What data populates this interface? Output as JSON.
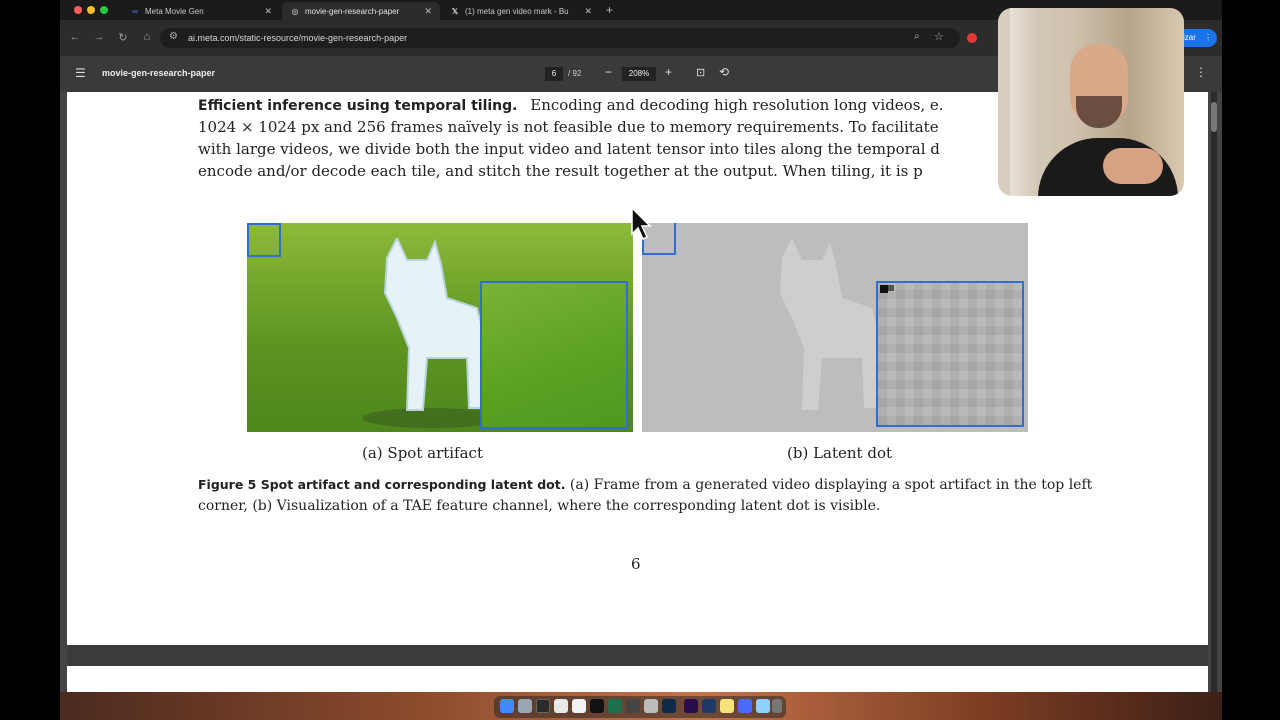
{
  "tabs": [
    {
      "label": "Meta Movie Gen",
      "favicon": "meta-icon",
      "active": false
    },
    {
      "label": "movie-gen-research-paper",
      "favicon": "globe-icon",
      "active": true
    },
    {
      "label": "(1) meta gen video mark - Bu",
      "favicon": "x-logo-icon",
      "active": false
    }
  ],
  "toolbar": {
    "url": "ai.meta.com/static-resource/movie-gen-research-paper",
    "profile_label": "izar"
  },
  "pdf": {
    "title": "movie-gen-research-paper",
    "current_page": "6",
    "total_pages": "/ 92",
    "zoom": "208%"
  },
  "page": {
    "paragraph_lead": "Efficient inference using temporal tiling.",
    "line1_rest": "Encoding and decoding high resolution long videos, e.",
    "line2": "1024 × 1024 px and 256 frames naïvely is not feasible due to memory requirements. To facilitate",
    "line3": "with large videos, we divide both the input video and latent tensor into tiles along the temporal d",
    "line4": "encode and/or decode each tile, and stitch the result together at the output. When tiling, it is p",
    "caption_a": "(a) Spot artifact",
    "caption_b": "(b) Latent dot",
    "figure_lead": "Figure 5  Spot artifact and corresponding latent dot.",
    "figure_text": "(a) Frame from a generated video displaying a spot artifact in the top left corner, (b) Visualization of a TAE feature channel, where the corresponding latent dot is visible.",
    "page_number": "6"
  },
  "colors": {
    "accent": "#1a73e8",
    "highlight_box": "#2f6fd3"
  }
}
